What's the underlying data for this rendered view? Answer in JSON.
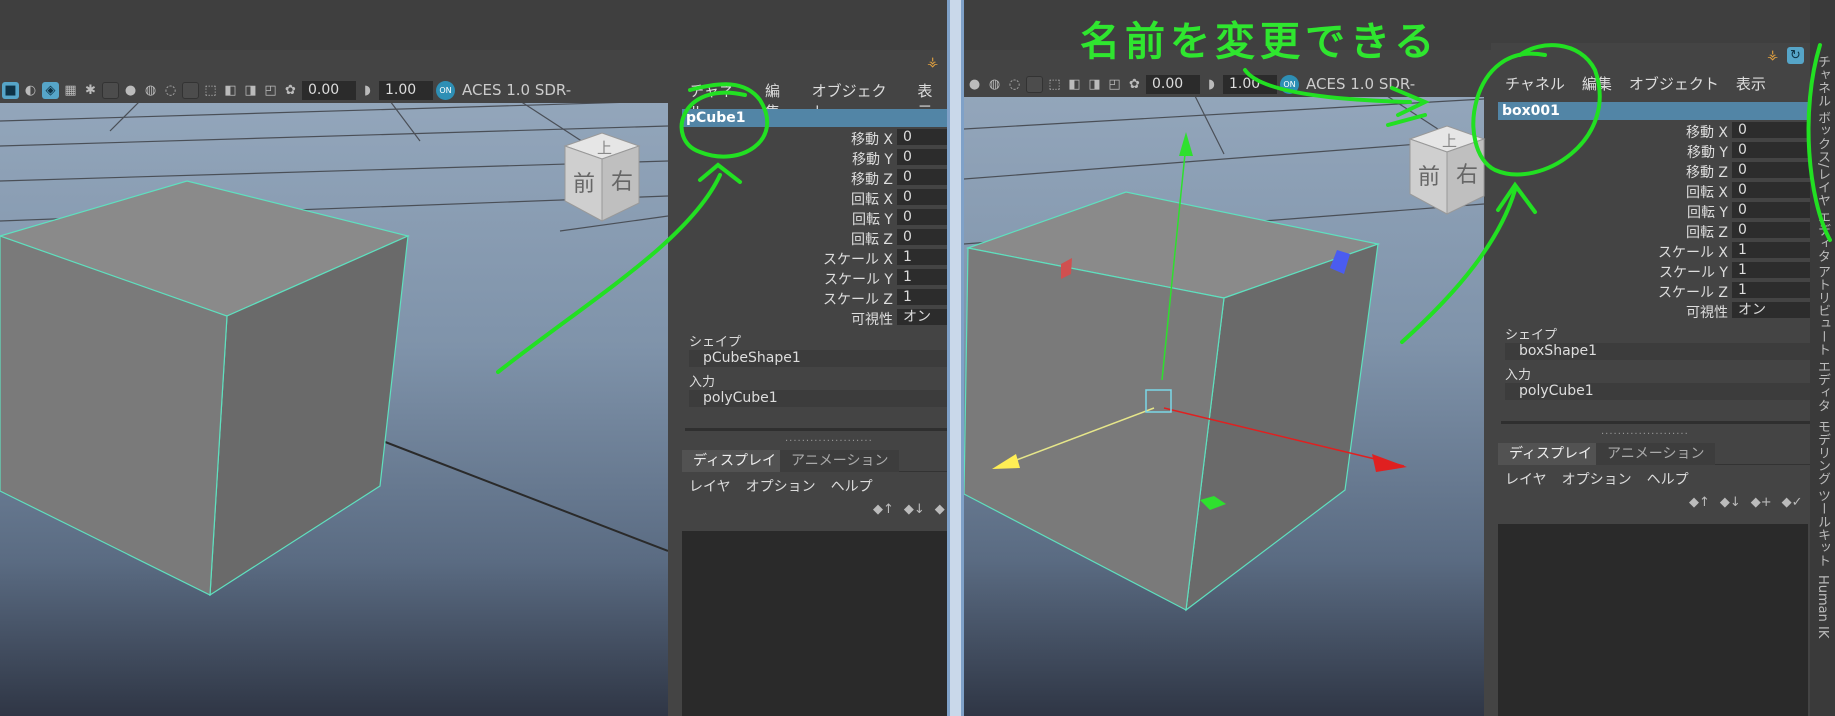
{
  "colors": {
    "annotation": "#22e022",
    "selection": "#5285a6",
    "wire": "#5fe0bf"
  },
  "annotation": {
    "text": "名前を変更できる"
  },
  "toolbar": {
    "value1": "0.00",
    "value2": "1.00",
    "colorspace": "ACES 1.0 SDR-",
    "on_badge": "ON"
  },
  "nav_cube": {
    "top": "上",
    "front": "前",
    "right": "右"
  },
  "channel_menu": [
    "チャネル",
    "編集",
    "オブジェクト",
    "表示"
  ],
  "left": {
    "object_name": "pCube1",
    "attributes": [
      {
        "label": "移動 X",
        "value": "0"
      },
      {
        "label": "移動 Y",
        "value": "0"
      },
      {
        "label": "移動 Z",
        "value": "0"
      },
      {
        "label": "回転 X",
        "value": "0"
      },
      {
        "label": "回転 Y",
        "value": "0"
      },
      {
        "label": "回転 Z",
        "value": "0"
      },
      {
        "label": "スケール X",
        "value": "1"
      },
      {
        "label": "スケール Y",
        "value": "1"
      },
      {
        "label": "スケール Z",
        "value": "1"
      },
      {
        "label": "可視性",
        "value": "オン"
      }
    ],
    "shape_header": "シェイプ",
    "shape_name": "pCubeShape1",
    "input_header": "入力",
    "input_name": "polyCube1"
  },
  "right": {
    "object_name": "box001",
    "attributes": [
      {
        "label": "移動 X",
        "value": "0"
      },
      {
        "label": "移動 Y",
        "value": "0"
      },
      {
        "label": "移動 Z",
        "value": "0"
      },
      {
        "label": "回転 X",
        "value": "0"
      },
      {
        "label": "回転 Y",
        "value": "0"
      },
      {
        "label": "回転 Z",
        "value": "0"
      },
      {
        "label": "スケール X",
        "value": "1"
      },
      {
        "label": "スケール Y",
        "value": "1"
      },
      {
        "label": "スケール Z",
        "value": "1"
      },
      {
        "label": "可視性",
        "value": "オン"
      }
    ],
    "shape_header": "シェイプ",
    "shape_name": "boxShape1",
    "input_header": "入力",
    "input_name": "polyCube1"
  },
  "layer_editor": {
    "tabs": [
      "ディスプレイ",
      "アニメーション"
    ],
    "menu": [
      "レイヤ",
      "オプション",
      "ヘルプ"
    ],
    "dots": "....................."
  },
  "side_tabs": [
    "チャネル ボックス/レイヤ エディタ",
    "アトリビュート エディタ",
    "モデリング ツールキット",
    "Human IK"
  ]
}
